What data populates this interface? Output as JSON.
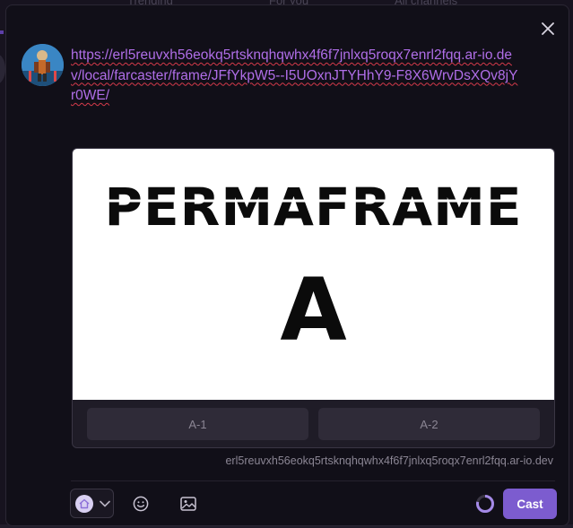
{
  "backdrop": {
    "nav_items": [
      "Trending",
      "For you",
      "All channels"
    ]
  },
  "composer": {
    "close_icon": "close-icon",
    "avatar_icon": "user-avatar",
    "text": "https://erl5reuvxh56eokq5rtsknqhqwhx4f6f7jnlxq5roqx7enrl2fqq.ar-io.dev/local/farcaster/frame/JFfYkpW5--I5UOxnJTYHhY9-F8X6WrvDsXQv8jYr0WE/",
    "frame": {
      "image_title": "PERMAFRAME",
      "image_subtitle": "A",
      "buttons": [
        "A-1",
        "A-2"
      ],
      "domain": "erl5reuvxh56eokq5rtsknqhqwhx4f6f7jnlxq5roqx7enrl2fqq.ar-io.dev"
    },
    "toolbar": {
      "channel_icon": "home-icon",
      "emoji_icon": "smiley-icon",
      "image_icon": "image-icon",
      "cast_label": "Cast",
      "accent": "#7c5ccf"
    }
  }
}
